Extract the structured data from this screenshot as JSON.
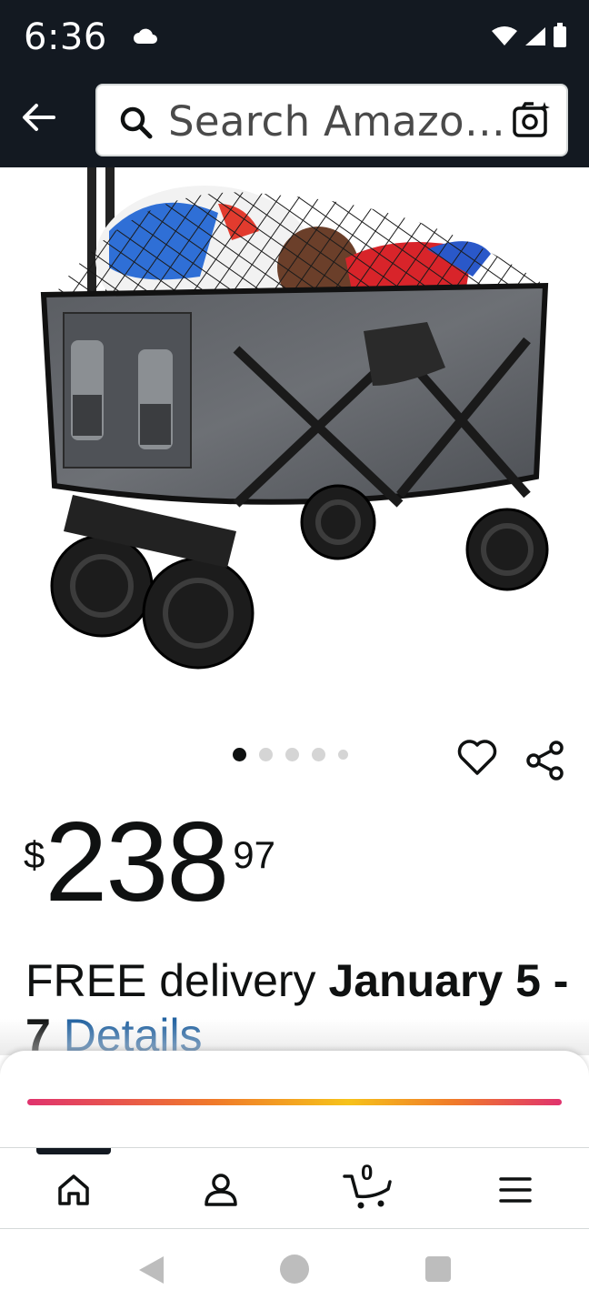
{
  "status_bar": {
    "time": "6:36"
  },
  "search": {
    "placeholder": "Search Amazo…"
  },
  "product": {
    "carousel": {
      "count": 5,
      "active_index": 0
    },
    "price": {
      "symbol": "$",
      "whole": "238",
      "fraction": "97"
    },
    "delivery": {
      "prefix": "FREE delivery ",
      "dates": "January 5 - 7",
      "details_link": "Details"
    }
  },
  "bottom_nav": {
    "items": [
      "home-icon",
      "account-icon",
      "cart-icon",
      "menu-icon"
    ],
    "cart_count": "0",
    "active": "home"
  },
  "colors": {
    "header_bg": "#131921",
    "link": "#2162a1",
    "gradient": [
      "#e0336e",
      "#f07a2a",
      "#f6c21a"
    ]
  }
}
